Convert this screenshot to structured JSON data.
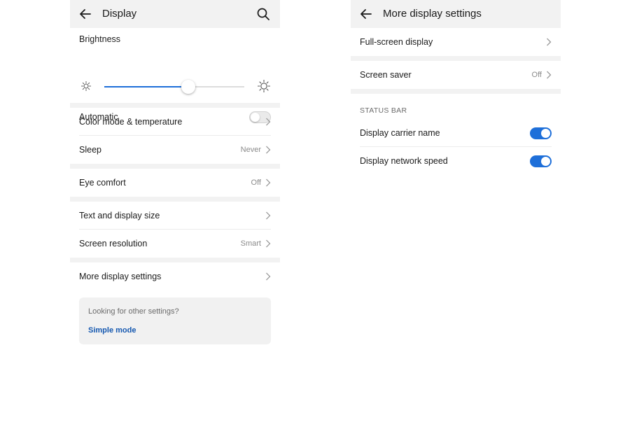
{
  "left": {
    "header": {
      "title": "Display"
    },
    "brightness": {
      "label": "Brightness",
      "level": 0.6
    },
    "automatic": {
      "label": "Automatic",
      "enabled": false
    },
    "items": [
      {
        "label": "Color mode & temperature",
        "value": ""
      },
      {
        "label": "Sleep",
        "value": "Never"
      },
      {
        "label": "Eye comfort",
        "value": "Off"
      },
      {
        "label": "Text and display size",
        "value": ""
      },
      {
        "label": "Screen resolution",
        "value": "Smart"
      },
      {
        "label": "More display settings",
        "value": ""
      }
    ],
    "tip": {
      "text": "Looking for other settings?",
      "link": "Simple mode"
    }
  },
  "right": {
    "header": {
      "title": "More display settings"
    },
    "items": [
      {
        "label": "Full-screen display",
        "value": ""
      },
      {
        "label": "Screen saver",
        "value": "Off"
      }
    ],
    "status_bar": {
      "title": "STATUS BAR",
      "items": [
        {
          "label": "Display carrier name",
          "enabled": true
        },
        {
          "label": "Display network speed",
          "enabled": true
        }
      ]
    }
  },
  "colors": {
    "accent": "#1e6fd9",
    "link": "#1558b0",
    "header_bg": "#f2f2f2"
  },
  "icons": {
    "back": "arrow-left-icon",
    "search": "search-icon",
    "chevron": "chevron-right-icon",
    "brightness_low": "sun-small-icon",
    "brightness_high": "sun-large-icon"
  }
}
